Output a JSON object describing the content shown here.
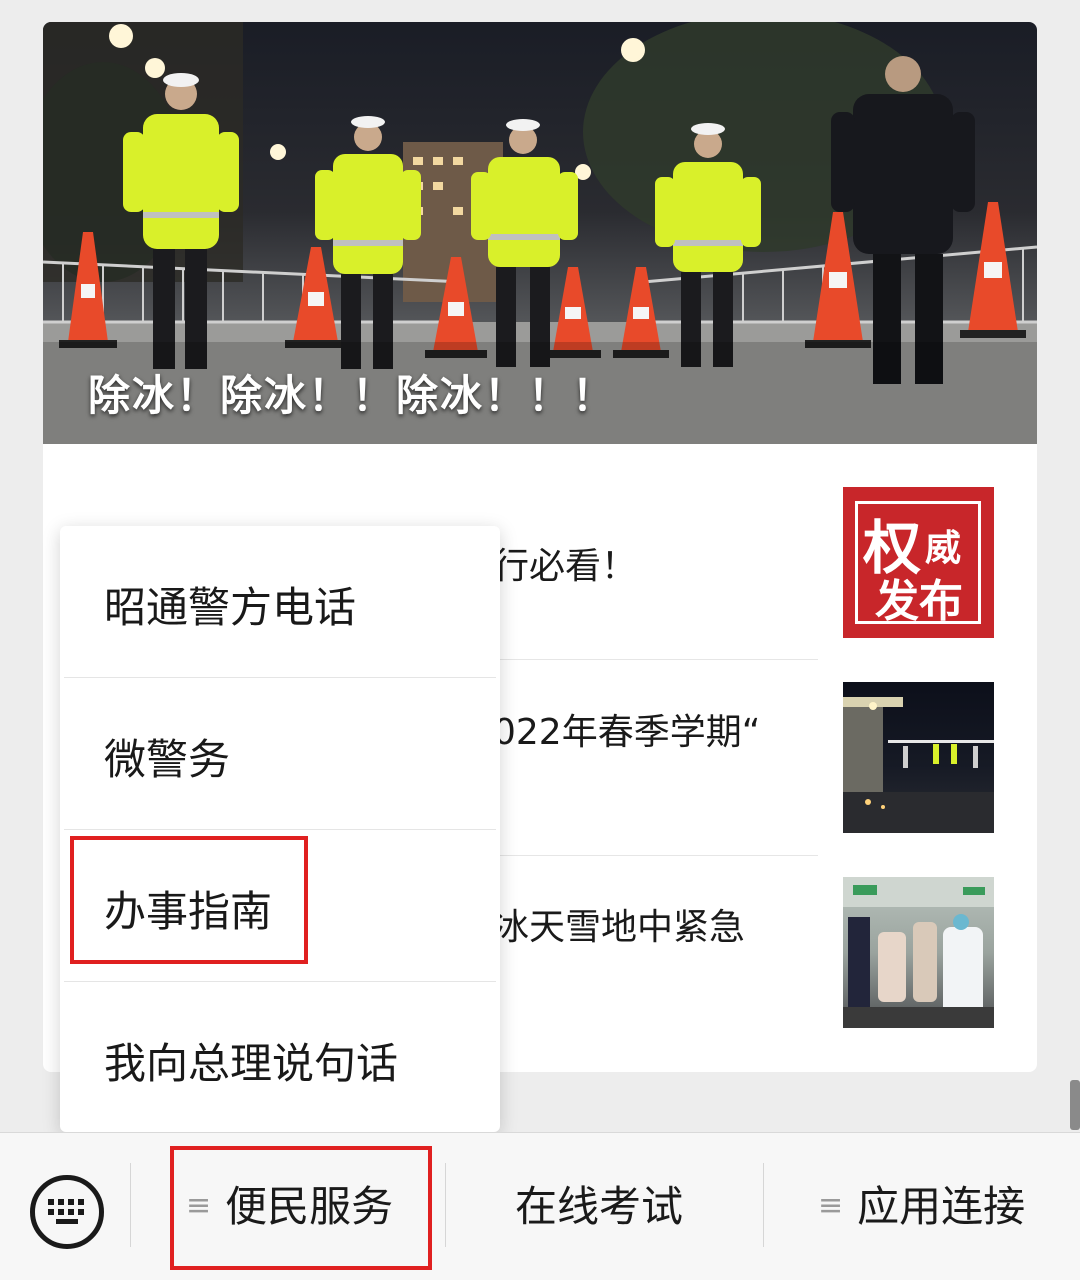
{
  "hero": {
    "caption": "除冰！除冰！！除冰！！！"
  },
  "articles": [
    {
      "title_visible": "行必看！",
      "thumbnail": {
        "big": "权",
        "small1": "威",
        "small2": "发布"
      }
    },
    {
      "title_visible": "022年春季学期“",
      "thumbnail": {
        "kind": "night-checkpoint-photo"
      }
    },
    {
      "title_visible": "冰天雪地中紧急",
      "thumbnail": {
        "kind": "hospital-photo"
      }
    }
  ],
  "popup_menu": {
    "items": [
      {
        "label": "昭通警方电话"
      },
      {
        "label": "微警务"
      },
      {
        "label": "办事指南",
        "highlighted": true
      },
      {
        "label": "我向总理说句话"
      }
    ]
  },
  "bottom_menu": {
    "keyboard_icon": "keyboard-icon",
    "items": [
      {
        "label": "便民服务",
        "has_menu_icon": true,
        "highlighted": true
      },
      {
        "label": "在线考试",
        "has_menu_icon": false
      },
      {
        "label": "应用连接",
        "has_menu_icon": true
      }
    ]
  },
  "colors": {
    "highlight_box": "#e02020",
    "thumbnail_red": "#c8262a",
    "vest_yellow": "#d9f02a"
  }
}
